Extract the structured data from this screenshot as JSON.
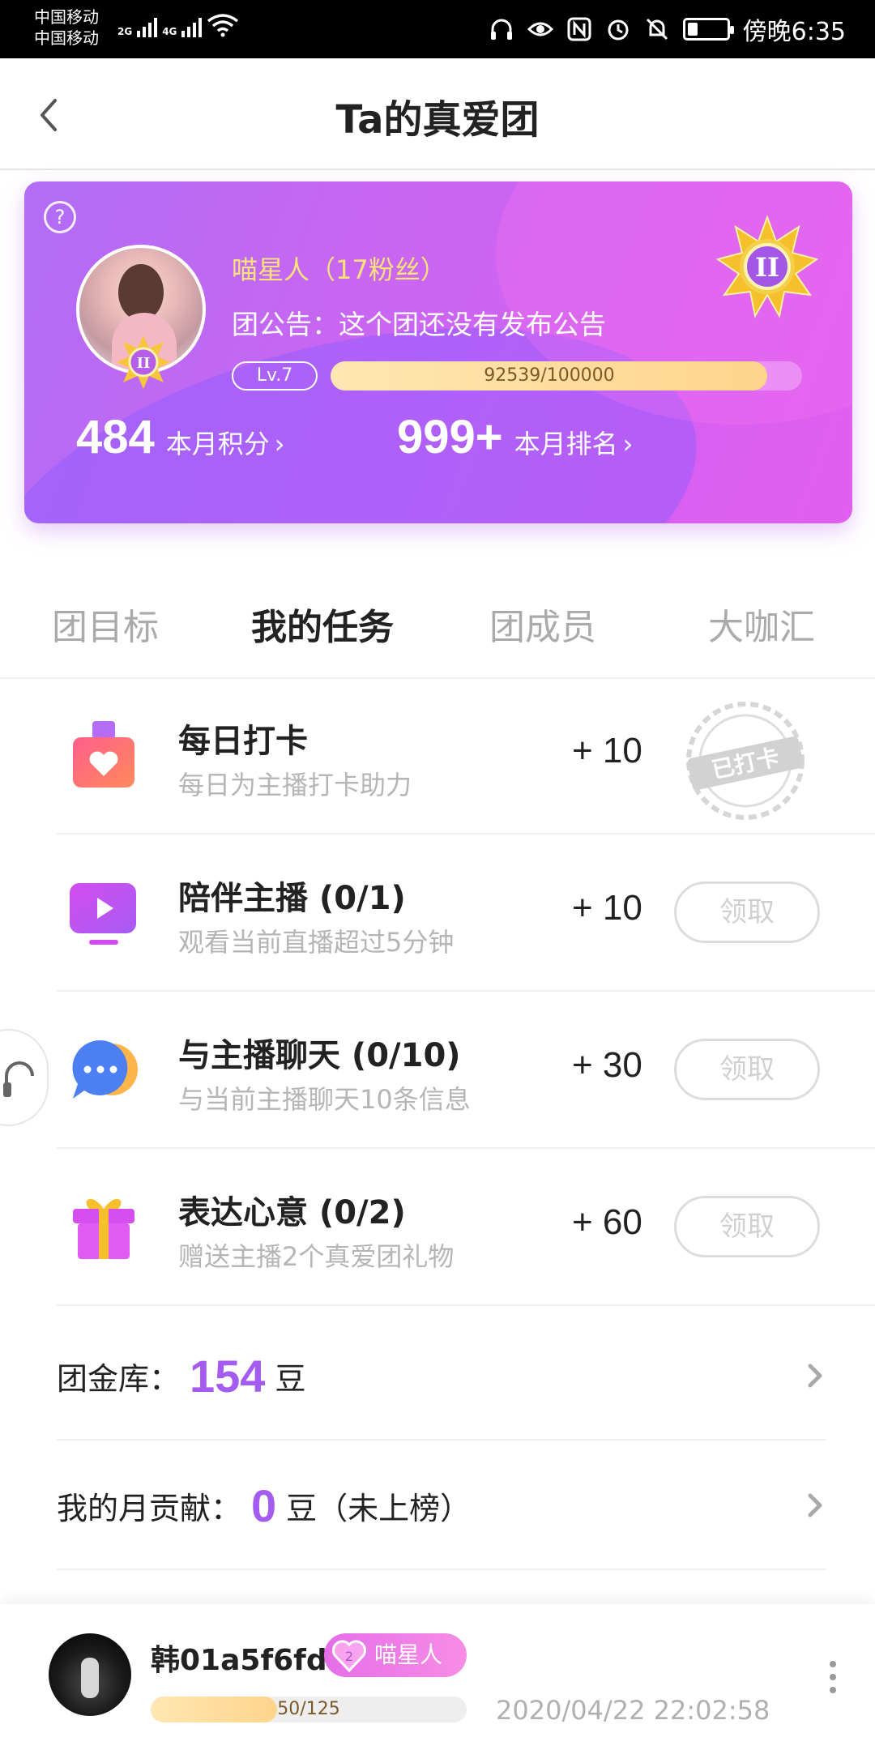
{
  "status_bar": {
    "carrier_1": "中国移动",
    "carrier_2": "中国移动",
    "net_1": "2G",
    "net_2": "4G",
    "time": "傍晚6:35"
  },
  "header": {
    "title": "Ta的真爱团"
  },
  "fan_card": {
    "anchor_name": "喵星人（17粉丝）",
    "announcement": "团公告：这个团还没有发布公告",
    "level": "Lv.7",
    "progress_text": "92539/100000",
    "progress_fraction": 0.92539,
    "score_value": "484",
    "score_label": "本月积分",
    "rank_value": "999+",
    "rank_label": "本月排名",
    "medal_numeral": "II"
  },
  "tabs": [
    {
      "label": "团目标",
      "active": false
    },
    {
      "label": "我的任务",
      "active": true
    },
    {
      "label": "团成员",
      "active": false
    },
    {
      "label": "大咖汇",
      "active": false
    }
  ],
  "tasks": [
    {
      "title": "每日打卡",
      "desc": "每日为主播打卡助力",
      "points": "+ 10",
      "status": "已打卡"
    },
    {
      "title": "陪伴主播 (0/1)",
      "desc": "观看当前直播超过5分钟",
      "points": "+ 10",
      "button": "领取"
    },
    {
      "title": "与主播聊天 (0/10)",
      "desc": "与当前主播聊天10条信息",
      "points": "+ 30",
      "button": "领取"
    },
    {
      "title": "表达心意 (0/2)",
      "desc": "赠送主播2个真爱团礼物",
      "points": "+ 60",
      "button": "领取"
    }
  ],
  "treasury": {
    "label": "团金库：",
    "value": "154",
    "unit": "豆"
  },
  "contribution": {
    "label": "我的月贡献：",
    "value": "0",
    "unit": "豆（未上榜）"
  },
  "member": {
    "name": "韩01a5f6fd",
    "badge_level": "2",
    "badge_label": "喵星人",
    "progress_text": "50/125",
    "progress_fraction": 0.4,
    "time": "2020/04/22 22:02:58"
  },
  "colors": {
    "card_gradient_start": "#b16cf6",
    "card_gradient_end": "#e05ef0",
    "accent_purple": "#a45cf0",
    "gold": "#ffe27a"
  }
}
